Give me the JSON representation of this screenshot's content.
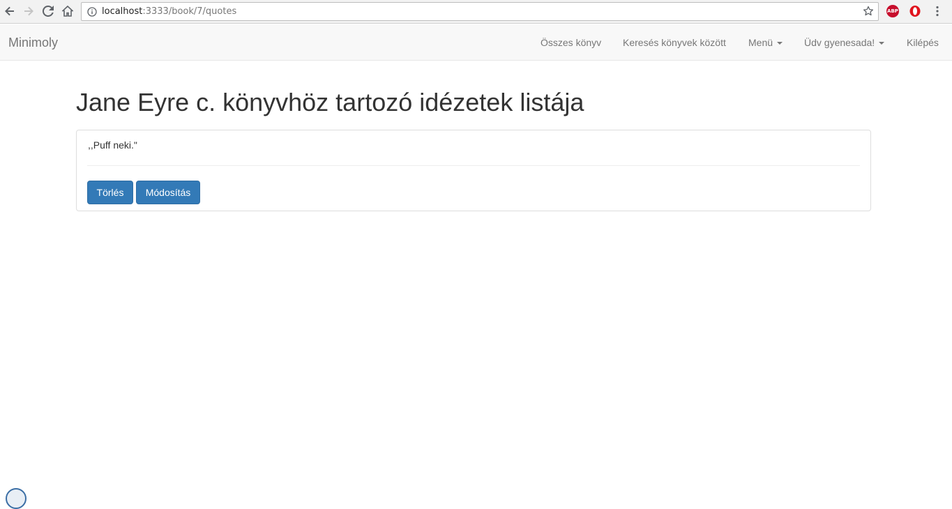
{
  "browser": {
    "url_host": "localhost",
    "url_path": ":3333/book/7/quotes",
    "extensions": {
      "adblock_label": "ABP"
    }
  },
  "navbar": {
    "brand": "Minimoly",
    "items": [
      {
        "label": "Összes könyv",
        "dropdown": false
      },
      {
        "label": "Keresés könyvek között",
        "dropdown": false
      },
      {
        "label": "Menü",
        "dropdown": true
      },
      {
        "label": "Üdv gyenesada!",
        "dropdown": true
      },
      {
        "label": "Kilépés",
        "dropdown": false
      }
    ]
  },
  "main": {
    "title": "Jane Eyre c. könyvhöz tartozó idézetek listája",
    "quotes": [
      {
        "text": ",,Puff neki.\"",
        "delete_label": "Törlés",
        "edit_label": "Módosítás"
      }
    ]
  },
  "colors": {
    "primary_button": "#337ab7",
    "navbar_bg": "#f8f8f8",
    "navbar_text": "#777777"
  }
}
